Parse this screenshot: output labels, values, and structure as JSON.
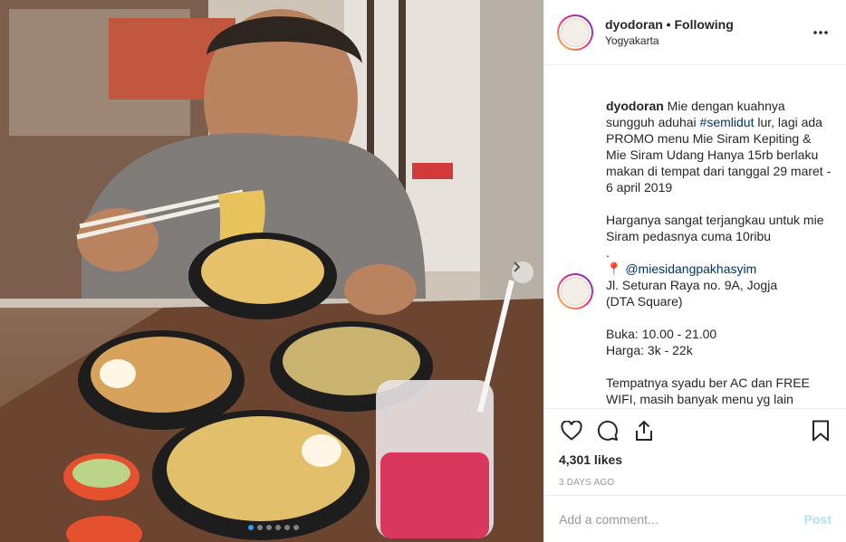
{
  "post": {
    "username": "dyodoran",
    "separator": "•",
    "follow_status": "Following",
    "location": "Yogyakarta",
    "caption_user": "dyodoran",
    "caption_segments": [
      {
        "text": " Mie dengan kuahnya sungguh aduhai ",
        "type": "text"
      },
      {
        "text": "#semlidut",
        "type": "link"
      },
      {
        "text": " lur, lagi ada PROMO menu Mie Siram Kepiting & Mie Siram Udang Hanya 15rb berlaku makan di tempat dari tanggal 29 maret - 6 april 2019\n\nHarganya sangat terjangkau untuk mie Siram pedasnya cuma 10ribu\n.\n📍 ",
        "type": "text"
      },
      {
        "text": "@miesidangpakhasyim",
        "type": "link"
      },
      {
        "text": "\nJl. Seturan Raya no. 9A, Jogja\n(DTA Square)\n\nBuka: 10.00 - 21.00\nHarga: 3k - 22k\n\nTempatnya syadu ber AC dan FREE WIFI, masih banyak menu yg lain langsung ke sana aja Lur",
        "type": "text"
      }
    ],
    "likes": "4,301 likes",
    "timestamp": "3 DAYS AGO"
  },
  "comment_box": {
    "placeholder": "Add a comment...",
    "post_label": "Post"
  },
  "icons": {
    "more": "more-options-icon",
    "like": "heart-icon",
    "comment": "comment-icon",
    "share": "share-icon",
    "save": "bookmark-icon",
    "next": "chevron-right-icon"
  },
  "colors": {
    "link": "#003569",
    "post_disabled": "#b2dffc",
    "carousel_active": "#3897f0",
    "muted": "#999999"
  },
  "carousel": {
    "total": 6,
    "active": 1
  }
}
